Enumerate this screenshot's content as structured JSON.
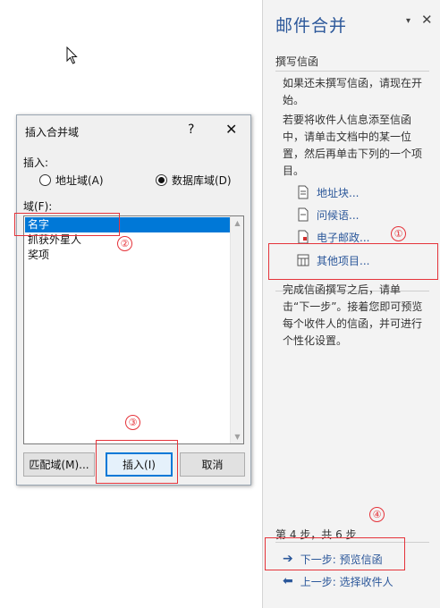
{
  "pane": {
    "title": "邮件合并",
    "dropdown_glyph": "▾",
    "close_glyph": "✕",
    "section": "撰写信函",
    "intro": "如果还未撰写信函，请现在开始。",
    "instruction": "若要将收件人信息添至信函中，请单击文档中的某一位置，然后再单击下列的一个项目。",
    "links": [
      "地址块...",
      "问候语...",
      "电子邮政...",
      "其他项目..."
    ],
    "after_text": "完成信函撰写之后，请单击“下一步”。接着您即可预览每个收件人的信函，并可进行个性化设置。",
    "step_text": "第 4 步，共 6 步",
    "next_link": "下一步: 预览信函",
    "prev_link": "上一步: 选择收件人"
  },
  "dialog": {
    "title": "插入合并域",
    "help": "?",
    "close": "✕",
    "insert_label": "插入:",
    "radio_address": "地址域(A)",
    "radio_database": "数据库域(D)",
    "selected_radio": "数据库域(D)",
    "fields_label": "域(F):",
    "fields": [
      "名字",
      "抓获外星人",
      "奖项"
    ],
    "selected_field": "名字",
    "btn_match": "匹配域(M)...",
    "btn_insert": "插入(I)",
    "btn_cancel": "取消"
  },
  "annotations": [
    "①",
    "②",
    "③",
    "④"
  ],
  "colors": {
    "accent": "#2b579a",
    "selection": "#0078d7",
    "annotation": "#e5333a"
  }
}
